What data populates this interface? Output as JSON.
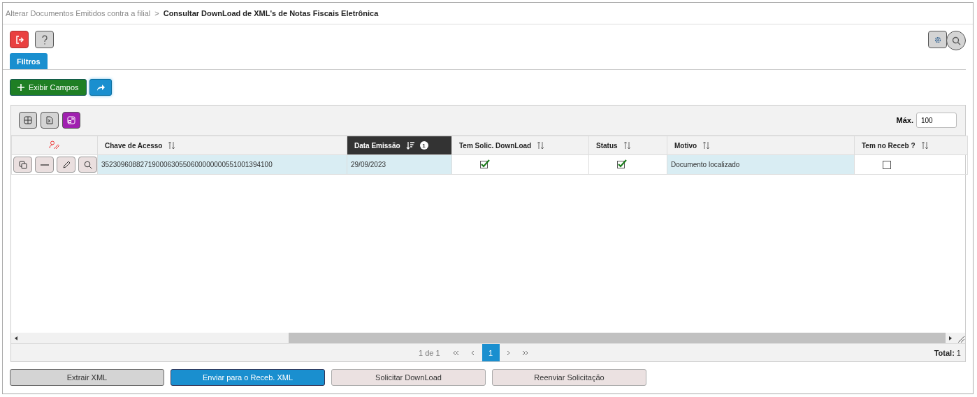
{
  "breadcrumb": {
    "parent": "Alterar Documentos Emitidos contra a filial",
    "separator": ">",
    "current": "Consultar DownLoad de XML's de Notas Fiscais Eletrônica"
  },
  "tabs": [
    {
      "label": "Filtros",
      "selected": true
    }
  ],
  "show_fields_button": "Exibir Campos",
  "max_field": {
    "label": "Máx.",
    "value": "100"
  },
  "table": {
    "columns": [
      {
        "label": "Chave de Acesso",
        "sorted": false,
        "highlighted": true
      },
      {
        "label": "Data Emissão",
        "sorted": true,
        "sort_order": "1",
        "highlighted": true
      },
      {
        "label": "Tem Solic. DownLoad",
        "sorted": false,
        "highlighted": false
      },
      {
        "label": "Status",
        "sorted": false,
        "highlighted": false
      },
      {
        "label": "Motivo",
        "sorted": false,
        "highlighted": true
      },
      {
        "label": "Tem no Receb ?",
        "sorted": false,
        "highlighted": false
      }
    ],
    "rows": [
      {
        "cells": [
          {
            "kind": "text",
            "text": "35230960882719000630550600000000551001394100"
          },
          {
            "kind": "text",
            "text": "29/09/2023"
          },
          {
            "kind": "check",
            "checked": true
          },
          {
            "kind": "check",
            "checked": true
          },
          {
            "kind": "text",
            "text": "Documento localizado"
          },
          {
            "kind": "check",
            "checked": false
          }
        ]
      }
    ]
  },
  "pager": {
    "info": "1 de 1",
    "pages": [
      {
        "label": "1",
        "selected": true
      }
    ],
    "total_label": "Total:",
    "total": "1"
  },
  "actions": [
    {
      "label": "Extrair XML",
      "kind": "neutral"
    },
    {
      "label": "Enviar para o Receb. XML",
      "kind": "primary"
    },
    {
      "label": "Solicitar DownLoad",
      "kind": "light"
    },
    {
      "label": "Reenviar Solicitação",
      "kind": "light"
    }
  ]
}
